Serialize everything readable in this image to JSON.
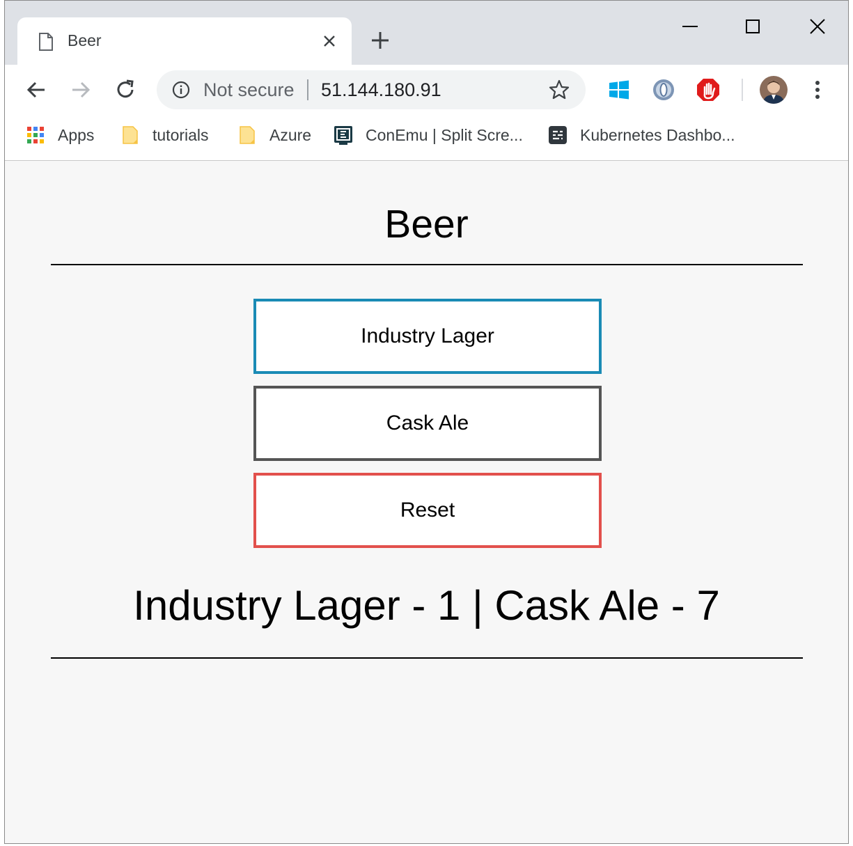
{
  "browser": {
    "tab": {
      "title": "Beer"
    },
    "omnibox": {
      "security_label": "Not secure",
      "url": "51.144.180.91"
    },
    "bookmarks": [
      {
        "label": "Apps",
        "icon": "apps-grid-icon"
      },
      {
        "label": "tutorials",
        "icon": "folder-icon"
      },
      {
        "label": "Azure",
        "icon": "folder-icon"
      },
      {
        "label": "ConEmu | Split Scre...",
        "icon": "conemu-icon"
      },
      {
        "label": "Kubernetes Dashbo...",
        "icon": "kubernetes-dashboard-icon"
      }
    ],
    "extensions": [
      "windows-icon",
      "extension-ring-icon",
      "adblock-icon"
    ]
  },
  "page": {
    "title": "Beer",
    "buttons": {
      "lager": "Industry Lager",
      "ale": "Cask Ale",
      "reset": "Reset"
    },
    "results": "Industry Lager - 1 | Cask Ale - 7"
  },
  "colors": {
    "lager_border": "#1a8bb5",
    "ale_border": "#555555",
    "reset_border": "#e2504c",
    "page_background": "#f7f7f7"
  }
}
